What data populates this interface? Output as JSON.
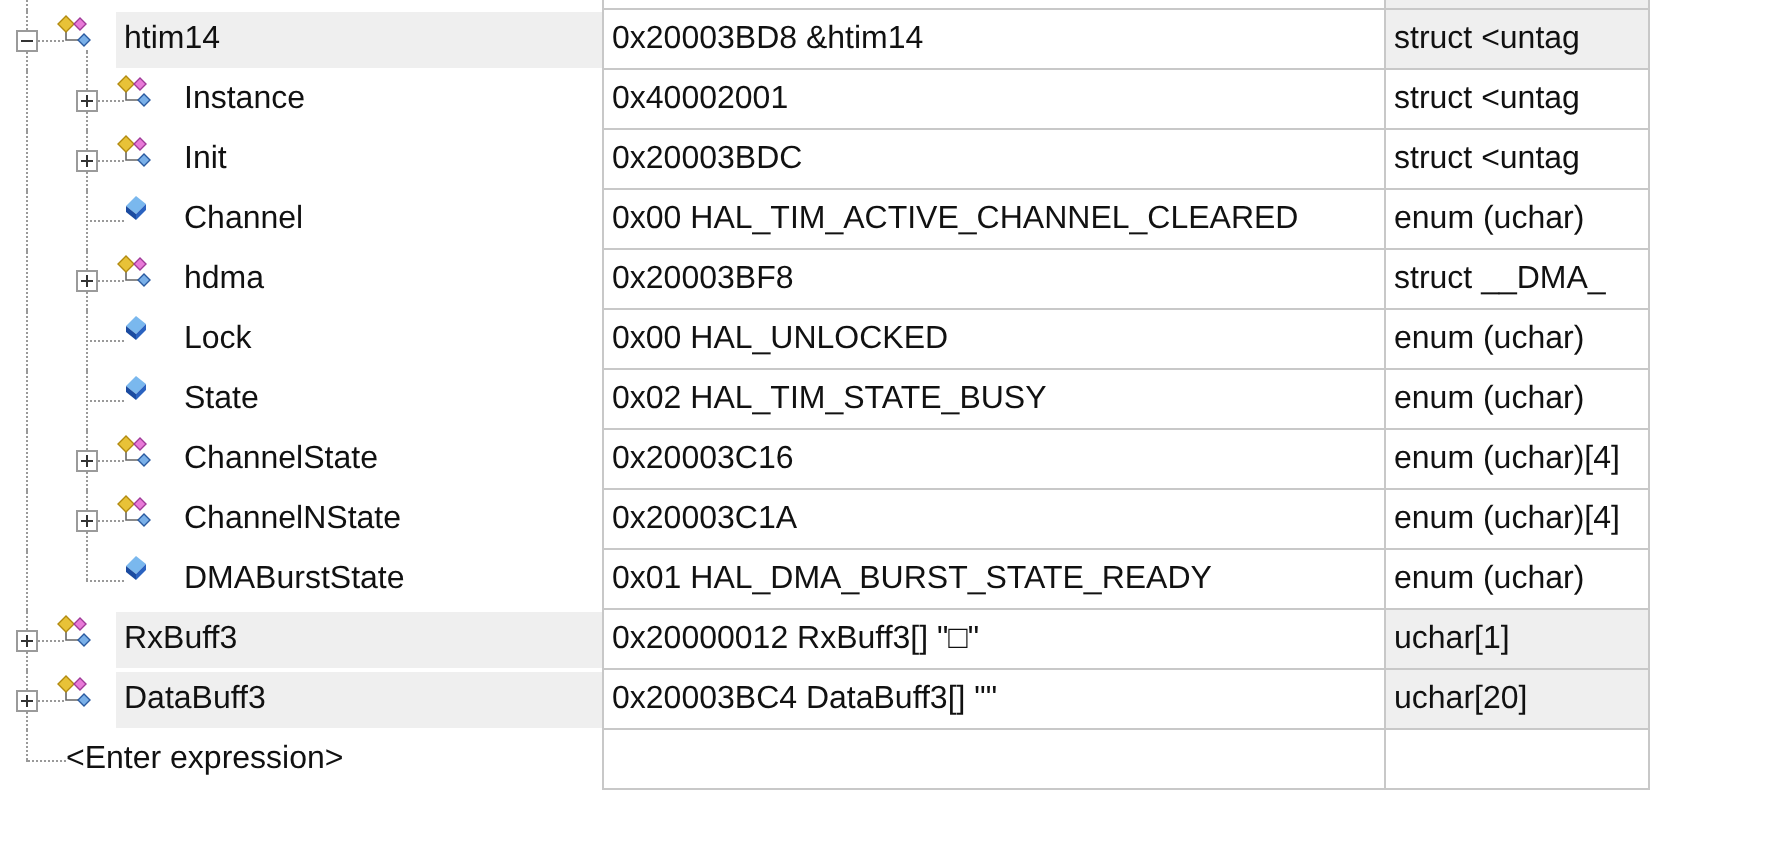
{
  "watch": {
    "items": [
      {
        "name": "htim14",
        "value": "0x20003BD8 &htim14",
        "type": "struct <untag",
        "kind": "struct",
        "expanded": true,
        "children": [
          {
            "name": "Instance",
            "value": "0x40002001",
            "type": "struct <untag",
            "kind": "struct",
            "expanded": false
          },
          {
            "name": "Init",
            "value": "0x20003BDC",
            "type": "struct <untag",
            "kind": "struct",
            "expanded": false
          },
          {
            "name": "Channel",
            "value": "0x00 HAL_TIM_ACTIVE_CHANNEL_CLEARED",
            "type": "enum (uchar)",
            "kind": "scalar"
          },
          {
            "name": "hdma",
            "value": "0x20003BF8",
            "type": "struct __DMA_",
            "kind": "struct",
            "expanded": false
          },
          {
            "name": "Lock",
            "value": "0x00 HAL_UNLOCKED",
            "type": "enum (uchar)",
            "kind": "scalar"
          },
          {
            "name": "State",
            "value": "0x02 HAL_TIM_STATE_BUSY",
            "type": "enum (uchar)",
            "kind": "scalar"
          },
          {
            "name": "ChannelState",
            "value": "0x20003C16",
            "type": "enum (uchar)[4]",
            "kind": "struct",
            "expanded": false
          },
          {
            "name": "ChannelNState",
            "value": "0x20003C1A",
            "type": "enum (uchar)[4]",
            "kind": "struct",
            "expanded": false
          },
          {
            "name": "DMABurstState",
            "value": "0x01 HAL_DMA_BURST_STATE_READY",
            "type": "enum (uchar)",
            "kind": "scalar"
          }
        ]
      },
      {
        "name": "RxBuff3",
        "value": "0x20000012 RxBuff3[] \"□\"",
        "type": "uchar[1]",
        "kind": "struct",
        "expanded": false
      },
      {
        "name": "DataBuff3",
        "value": "0x20003BC4 DataBuff3[] \"\"",
        "type": "uchar[20]",
        "kind": "struct",
        "expanded": false
      }
    ],
    "new_expression": "<Enter expression>"
  }
}
